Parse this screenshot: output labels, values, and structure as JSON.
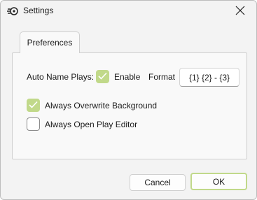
{
  "window": {
    "title": "Settings",
    "app_icon": "settings-app-icon",
    "close_icon": "close-icon"
  },
  "tabs": [
    {
      "label": "Preferences",
      "selected": true
    }
  ],
  "preferences": {
    "auto_name_label": "Auto Name Plays:",
    "enable": {
      "label": "Enable",
      "checked": true
    },
    "format_label": "Format",
    "format_value": "{1} {2} - {3}",
    "always_overwrite_background": {
      "label": "Always Overwrite Background",
      "checked": true
    },
    "always_open_play_editor": {
      "label": "Always Open Play Editor",
      "checked": false
    }
  },
  "buttons": {
    "cancel": "Cancel",
    "ok": "OK"
  },
  "colors": {
    "accent": "#c1d98a",
    "window_bg": "#f3f3f3",
    "panel_bg": "#f9f9f9"
  }
}
